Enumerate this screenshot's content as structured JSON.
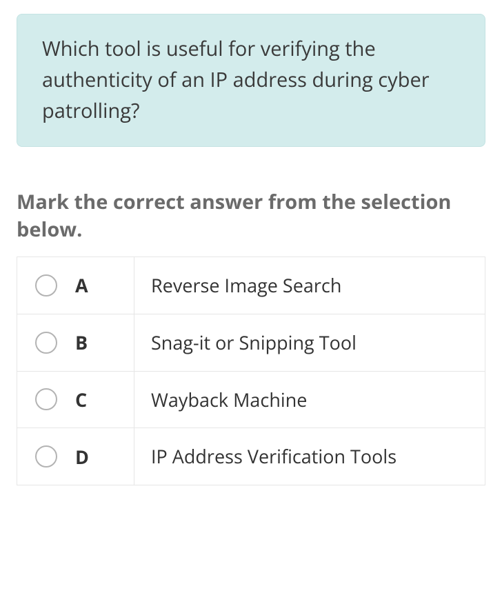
{
  "question": "Which tool is useful for verifying the authenticity of an IP address during cyber patrolling?",
  "instruction": "Mark the correct answer from the selection below.",
  "options": [
    {
      "letter": "A",
      "text": "Reverse Image Search"
    },
    {
      "letter": "B",
      "text": "Snag-it or Snipping Tool"
    },
    {
      "letter": "C",
      "text": "Wayback Machine"
    },
    {
      "letter": "D",
      "text": "IP Address Verification Tools"
    }
  ]
}
